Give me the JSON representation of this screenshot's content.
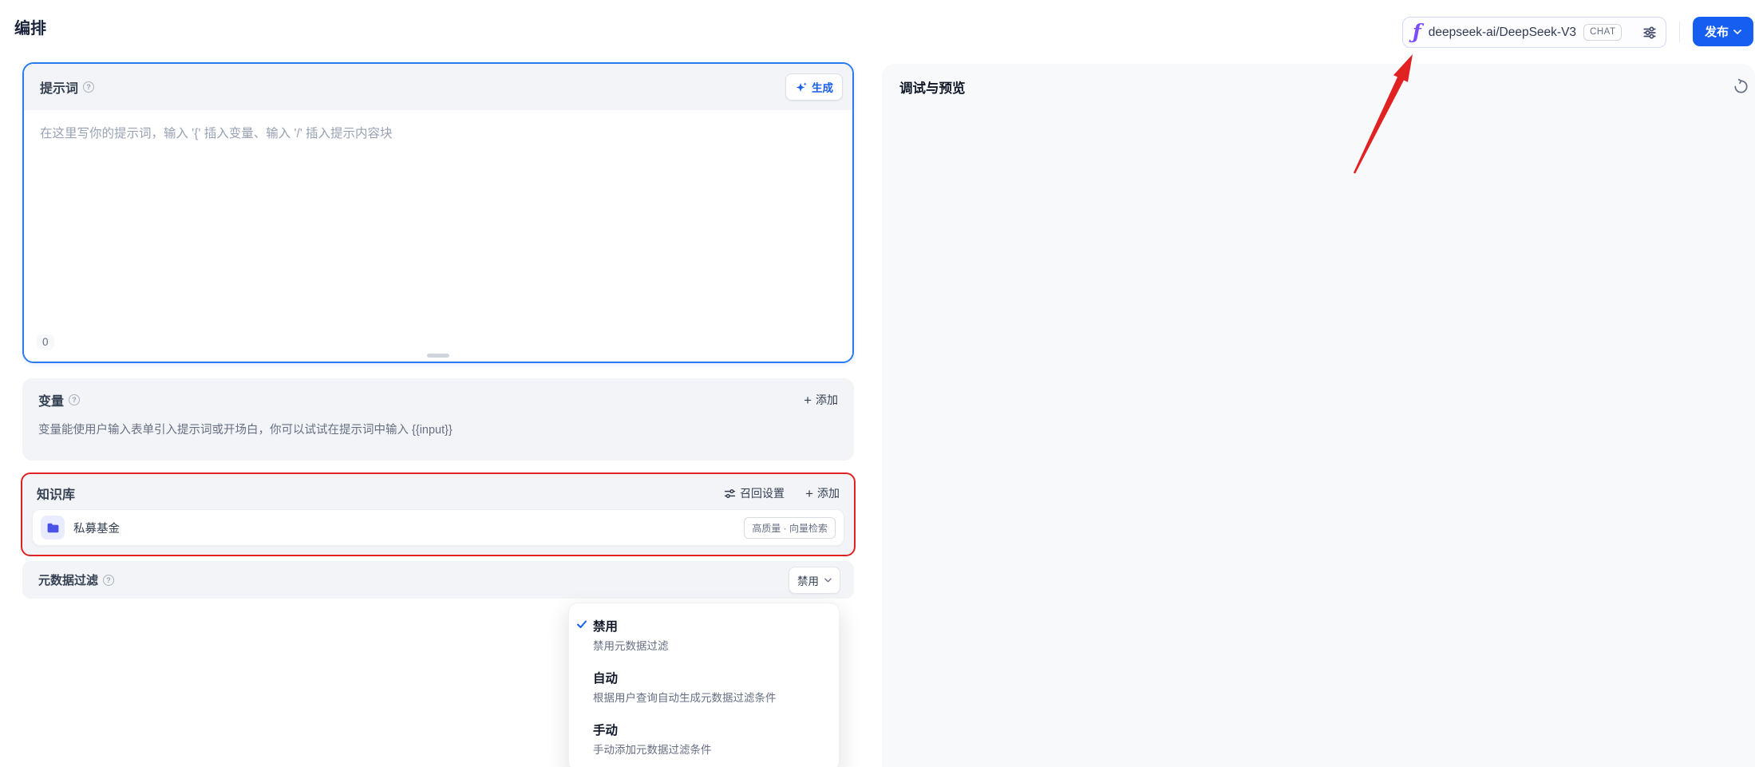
{
  "header": {
    "title": "编排",
    "model_selector": {
      "provider_icon": "siliconflow-icon",
      "model_name": "deepseek-ai/DeepSeek-V3",
      "mode_badge": "CHAT",
      "params_icon": "model-params-sliders-icon"
    },
    "publish_label": "发布"
  },
  "prompt": {
    "title": "提示词",
    "generate_label": "生成",
    "placeholder": "在这里写你的提示词，输入 '{' 插入变量、输入 '/' 插入提示内容块",
    "char_count": "0"
  },
  "variables": {
    "title": "变量",
    "add_label": "添加",
    "description": "变量能使用户输入表单引入提示词或开场白，你可以试试在提示词中输入 {{input}}"
  },
  "knowledge": {
    "title": "知识库",
    "recall_settings_label": "召回设置",
    "add_label": "添加",
    "items": [
      {
        "icon": "folder-icon",
        "name": "私募基金",
        "badge": "高质量 · 向量检索"
      }
    ]
  },
  "metadata_filter": {
    "title": "元数据过滤",
    "selected_value": "禁用",
    "options": [
      {
        "label": "禁用",
        "description": "禁用元数据过滤",
        "selected": true
      },
      {
        "label": "自动",
        "description": "根据用户查询自动生成元数据过滤条件",
        "selected": false
      },
      {
        "label": "手动",
        "description": "手动添加元数据过滤条件",
        "selected": false
      }
    ]
  },
  "debug_panel": {
    "title": "调试与预览"
  },
  "colors": {
    "accent_blue": "#155eef",
    "annotation_red": "#e02222",
    "provider_purple": "#7c4dff",
    "section_gray": "#f2f4f7",
    "debug_panel_gray": "#f8f9fb"
  }
}
